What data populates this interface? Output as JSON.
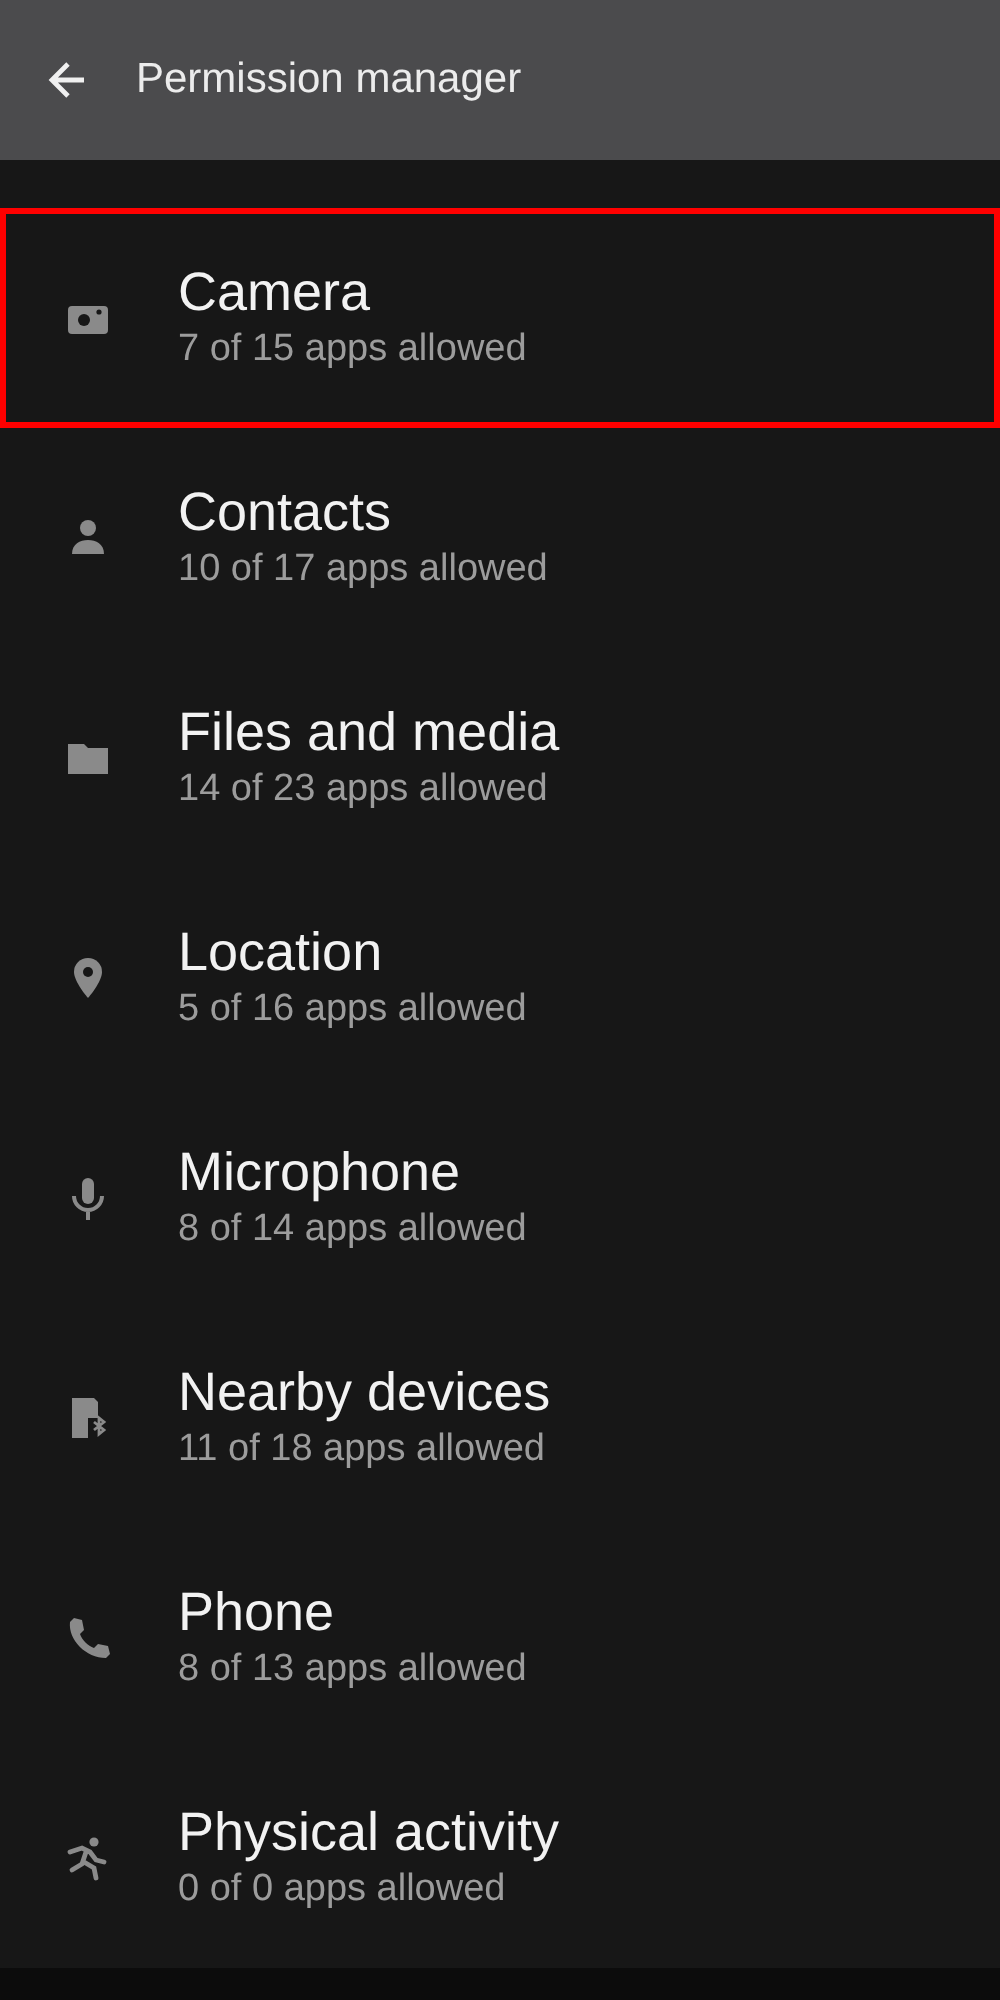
{
  "app_bar": {
    "title": "Permission manager"
  },
  "permissions": [
    {
      "kind": "camera",
      "title": "Camera",
      "summary": "7 of 15 apps allowed",
      "highlighted": true
    },
    {
      "kind": "person",
      "title": "Contacts",
      "summary": "10 of 17 apps allowed",
      "highlighted": false
    },
    {
      "kind": "folder",
      "title": "Files and media",
      "summary": "14 of 23 apps allowed",
      "highlighted": false
    },
    {
      "kind": "location",
      "title": "Location",
      "summary": "5 of 16 apps allowed",
      "highlighted": false
    },
    {
      "kind": "microphone",
      "title": "Microphone",
      "summary": "8 of 14 apps allowed",
      "highlighted": false
    },
    {
      "kind": "nearby",
      "title": "Nearby devices",
      "summary": "11 of 18 apps allowed",
      "highlighted": false
    },
    {
      "kind": "phone",
      "title": "Phone",
      "summary": "8 of 13 apps allowed",
      "highlighted": false
    },
    {
      "kind": "activity",
      "title": "Physical activity",
      "summary": "0 of 0 apps allowed",
      "highlighted": false
    }
  ]
}
